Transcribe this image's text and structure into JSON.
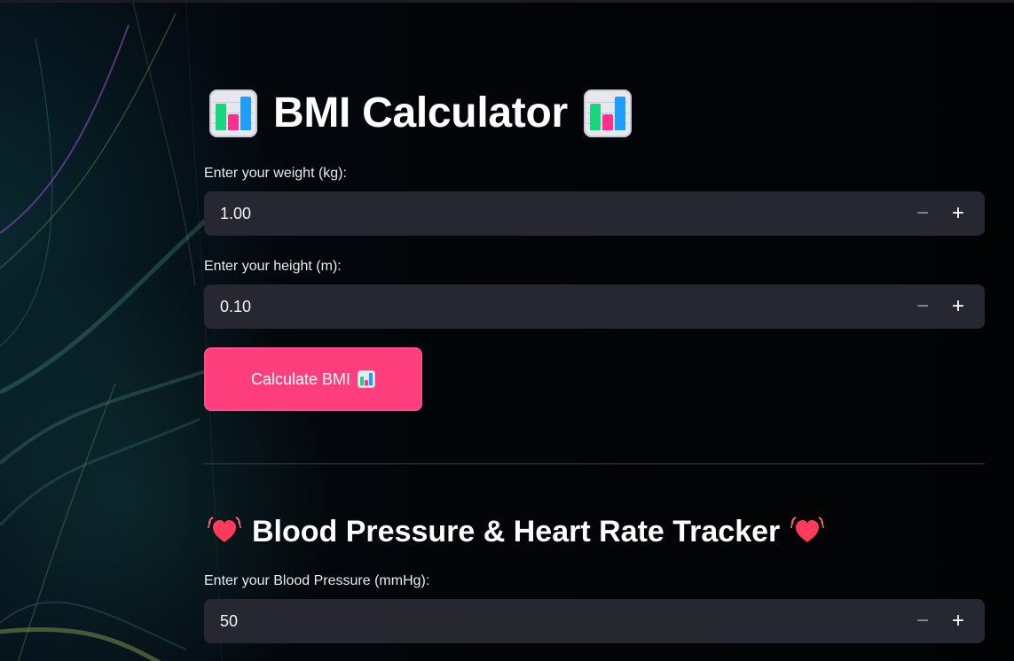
{
  "bmi_section": {
    "title": "BMI Calculator",
    "title_icon_left": "bar-chart-icon",
    "title_icon_right": "bar-chart-icon",
    "weight_label": "Enter your weight (kg):",
    "weight_value": "1.00",
    "height_label": "Enter your height (m):",
    "height_value": "0.10",
    "button_label": "Calculate BMI",
    "button_icon": "bar-chart-icon",
    "stepper_minus": "−",
    "stepper_plus": "+"
  },
  "vitals_section": {
    "title": "Blood Pressure & Heart Rate Tracker",
    "title_icon_left": "beating-heart-icon",
    "title_icon_right": "beating-heart-icon",
    "blood_pressure_label": "Enter your Blood Pressure (mmHg):",
    "blood_pressure_value": "50",
    "stepper_minus": "−",
    "stepper_plus": "+"
  },
  "colors": {
    "background": "#05070a",
    "input_background": "#262730",
    "button_accent": "#ff3f7d",
    "divider": "#3a3d45"
  }
}
